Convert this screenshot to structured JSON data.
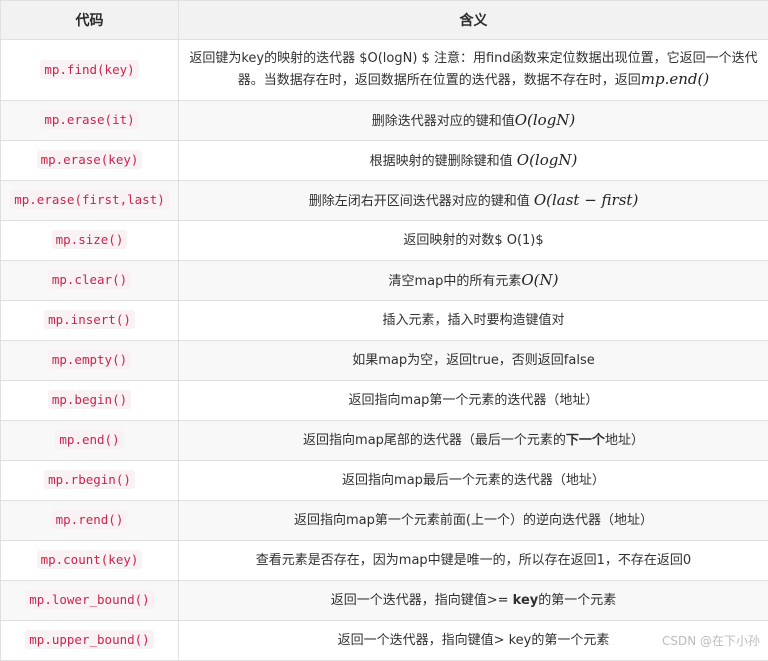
{
  "headers": {
    "code": "代码",
    "meaning": "含义"
  },
  "rows": [
    {
      "code": "mp.find(key)",
      "desc_a": "返回键为key的映射的迭代器 $O(logN) $ 注意：用find函数来定位数据出现位置，它返回一个迭代器。当数据存在时，返回数据所在位置的迭代器，数据不存在时，返回",
      "math": "mp.end()"
    },
    {
      "code": "mp.erase(it)",
      "desc_a": "删除迭代器对应的键和值",
      "math": "O(logN)"
    },
    {
      "code": "mp.erase(key)",
      "desc_a": "根据映射的键删除键和值 ",
      "math": "O(logN)"
    },
    {
      "code": "mp.erase(first,last)",
      "desc_a": "删除左闭右开区间迭代器对应的键和值 ",
      "math": "O(last − first)"
    },
    {
      "code": "mp.size()",
      "desc_a": "返回映射的对数$ O(1)$"
    },
    {
      "code": "mp.clear()",
      "desc_a": "清空map中的所有元素",
      "math": "O(N)"
    },
    {
      "code": "mp.insert()",
      "desc_a": "插入元素，插入时要构造键值对"
    },
    {
      "code": "mp.empty()",
      "desc_a": "如果map为空，返回true，否则返回false"
    },
    {
      "code": "mp.begin()",
      "desc_a": "返回指向map第一个元素的迭代器（地址）"
    },
    {
      "code": "mp.end()",
      "desc_a": "返回指向map尾部的迭代器（最后一个元素的",
      "desc_bold": "下一个",
      "desc_b": "地址）"
    },
    {
      "code": "mp.rbegin()",
      "desc_a": "返回指向map最后一个元素的迭代器（地址）"
    },
    {
      "code": "mp.rend()",
      "desc_a": "返回指向map第一个元素前面(上一个）的逆向迭代器（地址）"
    },
    {
      "code": "mp.count(key)",
      "desc_a": "查看元素是否存在，因为map中键是唯一的，所以存在返回1，不存在返回0"
    },
    {
      "code": "mp.lower_bound()",
      "desc_a": "返回一个迭代器，指向键值>= ",
      "desc_bold": "key",
      "desc_b": "的第一个元素"
    },
    {
      "code": "mp.upper_bound()",
      "desc_a": "返回一个迭代器，指向键值> key的第一个元素"
    }
  ],
  "watermark": "CSDN @在下小孙"
}
